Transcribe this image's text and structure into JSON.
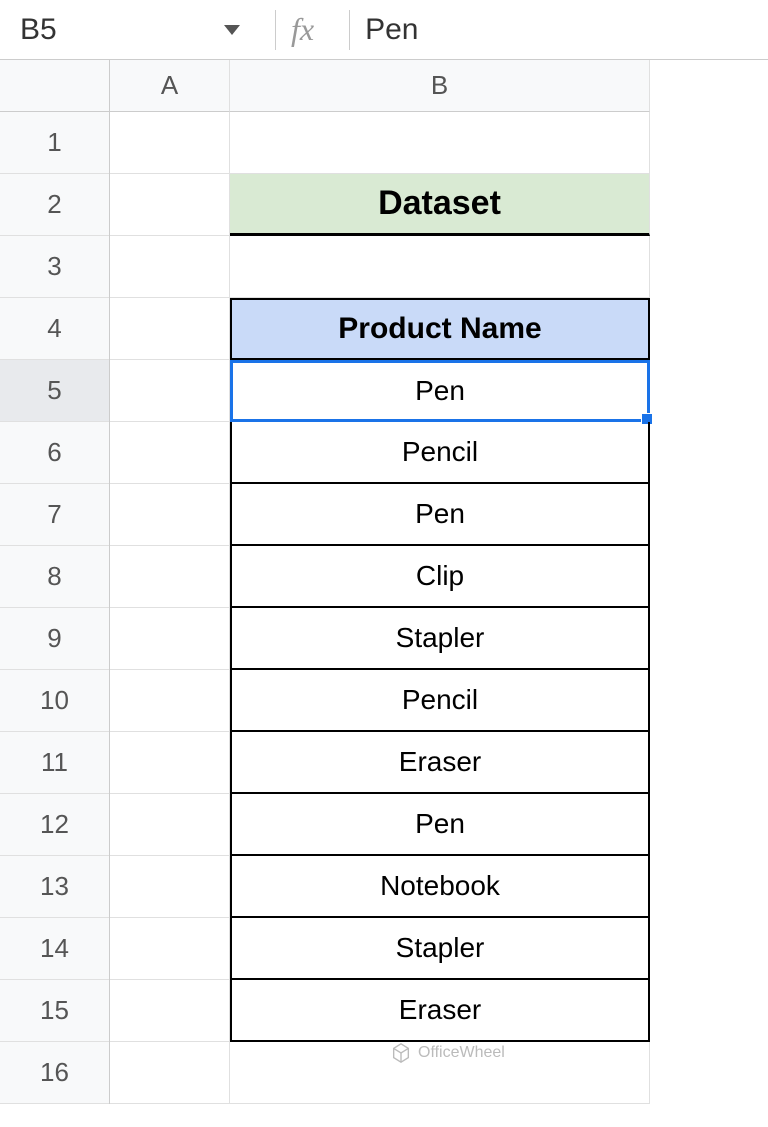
{
  "formula_bar": {
    "name_box": "B5",
    "fx_label": "fx",
    "formula_value": "Pen"
  },
  "columns": {
    "a": "A",
    "b": "B"
  },
  "rows": [
    "1",
    "2",
    "3",
    "4",
    "5",
    "6",
    "7",
    "8",
    "9",
    "10",
    "11",
    "12",
    "13",
    "14",
    "15",
    "16"
  ],
  "selected_row": "5",
  "cells": {
    "b2": "Dataset",
    "b4": "Product Name",
    "b5": "Pen",
    "b6": "Pencil",
    "b7": "Pen",
    "b8": "Clip",
    "b9": "Stapler",
    "b10": "Pencil",
    "b11": "Eraser",
    "b12": "Pen",
    "b13": "Notebook",
    "b14": "Stapler",
    "b15": "Eraser"
  },
  "watermark": "OfficeWheel"
}
